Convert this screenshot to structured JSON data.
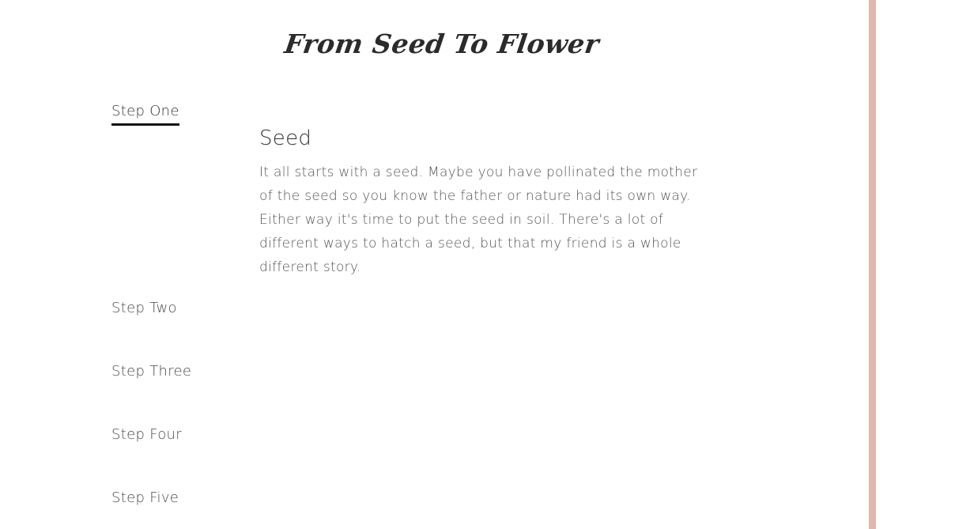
{
  "page": {
    "title": "From Seed To Flower"
  },
  "steps": [
    {
      "label": "Step One",
      "active": true
    },
    {
      "label": "Step Two",
      "active": false
    },
    {
      "label": "Step Three",
      "active": false
    },
    {
      "label": "Step Four",
      "active": false
    },
    {
      "label": "Step Five",
      "active": false
    }
  ],
  "content": {
    "heading": "Seed",
    "body": "It all starts with a seed. Maybe you have pollinated the mother of the seed so you know the father or nature had its own way. Either way it's time to put the seed in soil. There's a lot of different ways to hatch a seed, but that my friend is a whole different story."
  },
  "colors": {
    "accent_stripe": "#e2b8ad",
    "active_underline": "#111111"
  }
}
